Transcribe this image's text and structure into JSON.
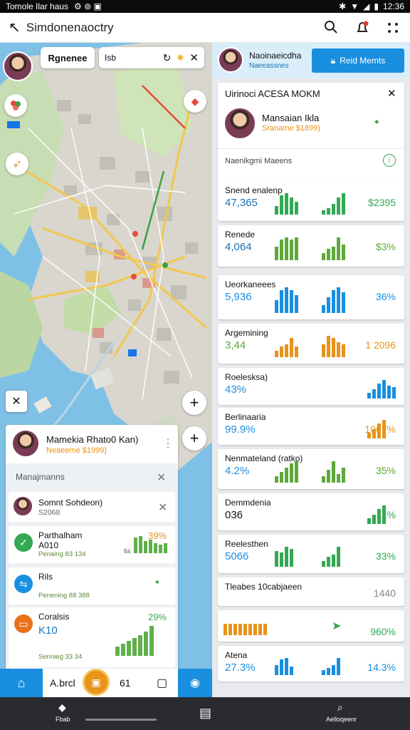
{
  "status_bar": {
    "left_text": "Tomole Ilar haus",
    "time": "12:36"
  },
  "search": {
    "query": "Simdonenaoctry"
  },
  "map": {
    "chip_label": "Rgnenee",
    "chip2_text": "Isb",
    "plus_label": "+"
  },
  "left_panel": {
    "profile": {
      "name": "Mamekia Rhato0 Kan)",
      "sub": "Neaeeme $1999)"
    },
    "section_label": "Manajmanns",
    "contact": {
      "name": "Somnt Sohdeon)",
      "sub": "S2068"
    },
    "items": [
      {
        "title": "Parthalham",
        "value": "A010",
        "sub": "Penaing 83 134",
        "pct": "39%",
        "icon_color": "#34a853",
        "bar_color": "#5fb04a",
        "bars": [
          0.9,
          1.0,
          0.7,
          0.8,
          0.6,
          0.5,
          0.6
        ],
        "prefix": "6s"
      },
      {
        "title": "Rils",
        "value": "",
        "sub": "Penening 88 388",
        "pct": "",
        "icon_color": "#1a8fe0",
        "bar_color": "#34a853",
        "bars": [],
        "prefix": ""
      },
      {
        "title": "Coralsis",
        "value": "K10",
        "sub": "Sennieg 33 34",
        "pct": "29%",
        "icon_color": "#e8711a",
        "bar_color": "#5fb04a",
        "bars": [
          0.3,
          0.4,
          0.5,
          0.6,
          0.7,
          0.8,
          1.0
        ],
        "prefix": ""
      }
    ]
  },
  "bottom_nav": {
    "label": "A.brcl",
    "number": "61"
  },
  "right_panel": {
    "header_name": "Naoinaeicdha",
    "header_sub": "Naeeassnes",
    "header_button": "Reid Memts",
    "card_title": "Uirinoci ACESA MOKM",
    "profile": {
      "name": "Mansaian Ikla",
      "sub": "Sraname $1899)"
    },
    "sub_section": "Naenikgmi Maeens",
    "rows": [
      {
        "label": "Snend enalenp",
        "value": "47,365",
        "pct": "$2395",
        "color": "#34a853",
        "value_color": "#1a73b8",
        "bars1": [
          0.4,
          0.9,
          1.0,
          0.8,
          0.6
        ],
        "bars2": [
          0.2,
          0.3,
          0.5,
          0.8,
          1.0
        ]
      },
      {
        "label": "Renede",
        "value": "4,064",
        "pct": "$3%",
        "color": "#5fa83a",
        "value_color": "#1a73b8",
        "bars1": [
          0.6,
          0.9,
          1.0,
          0.9,
          1.0
        ],
        "bars2": [
          0.3,
          0.5,
          0.6,
          1.0,
          0.7
        ]
      },
      {
        "label": "Ueorkaneees",
        "value": "5,936",
        "pct": "36%",
        "color": "#1a8fe0",
        "value_color": "#1a8fe0",
        "bars1": [
          0.5,
          0.9,
          1.0,
          0.9,
          0.7
        ],
        "bars2": [
          0.3,
          0.6,
          0.9,
          1.0,
          0.8
        ]
      },
      {
        "label": "Argemining",
        "value": "3,44",
        "pct": "1 2096",
        "color": "#e8931a",
        "value_color": "#5fa83a",
        "bars1": [
          0.3,
          0.5,
          0.6,
          0.9,
          0.5
        ],
        "bars2": [
          0.6,
          1.0,
          0.9,
          0.7,
          0.6
        ]
      },
      {
        "label": "Roelesksa)",
        "value": "43%",
        "pct": "",
        "color": "#1a8fe0",
        "value_color": "#1a8fe0",
        "bars1": [],
        "bars2": [
          0.3,
          0.5,
          0.8,
          1.0,
          0.7,
          0.6
        ]
      },
      {
        "label": "Berlinaaria",
        "value": "99.9%",
        "pct": "1067%",
        "color": "#e8931a",
        "value_color": "#1a8fe0",
        "bars1": [],
        "bars2": [
          0.3,
          0.5,
          0.8,
          1.0
        ]
      },
      {
        "label": "Nenmateland (ratko)",
        "value": "4.2%",
        "pct": "35%",
        "color": "#5fa83a",
        "value_color": "#1a8fe0",
        "bars1": [
          0.3,
          0.5,
          0.7,
          0.9,
          1.0
        ],
        "bars2": [
          0.3,
          0.6,
          1.0,
          0.4,
          0.7
        ]
      },
      {
        "label": "Demmdenia",
        "value": "036",
        "pct": "11%",
        "color": "#34a853",
        "value_color": "#111",
        "bars1": [],
        "bars2": [
          0.3,
          0.5,
          0.8,
          1.0
        ]
      },
      {
        "label": "Reelesthen",
        "value": "5066",
        "pct": "33%",
        "color": "#34a853",
        "value_color": "#1a8fe0",
        "bars1": [
          0.8,
          0.7,
          1.0,
          0.9
        ],
        "bars2": [
          0.3,
          0.5,
          0.6,
          1.0
        ]
      },
      {
        "label": "Tleabes 10cabjaeen",
        "value": "",
        "pct": "1440",
        "color": "#888",
        "value_color": "#111",
        "bars1": [],
        "bars2": []
      },
      {
        "label": "",
        "value": "",
        "pct": "960%",
        "color": "#34a853",
        "value_color": "#111",
        "bars1": [
          0.9,
          0.9,
          0.9,
          0.9,
          0.9,
          0.9,
          0.9,
          0.9,
          0.9
        ],
        "bars2": []
      },
      {
        "label": "Atena",
        "value": "27.3%",
        "pct": "14.3%",
        "color": "#1a8fe0",
        "value_color": "#1a8fe0",
        "bars1": [
          0.6,
          0.9,
          1.0,
          0.5
        ],
        "bars2": [
          0.3,
          0.4,
          0.6,
          1.0
        ]
      }
    ]
  },
  "system_nav": {
    "left_label": "Fbab",
    "right_label": "Aelloqeenr"
  }
}
